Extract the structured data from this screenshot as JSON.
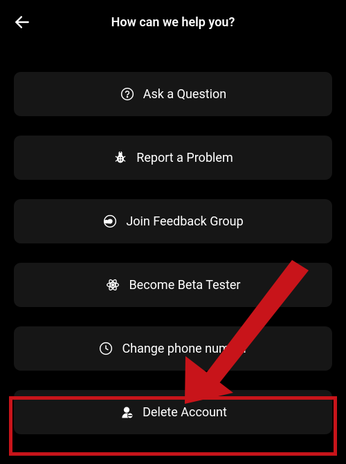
{
  "header": {
    "title": "How can we help you?"
  },
  "options": {
    "ask_question": {
      "label": "Ask a Question",
      "icon": "question-circle-icon"
    },
    "report_problem": {
      "label": "Report a Problem",
      "icon": "bug-icon"
    },
    "feedback_group": {
      "label": "Join Feedback Group",
      "icon": "chat-bubble-icon"
    },
    "beta_tester": {
      "label": "Become Beta Tester",
      "icon": "atom-icon"
    },
    "change_phone": {
      "label": "Change phone number",
      "icon": "clock-icon"
    },
    "delete_account": {
      "label": "Delete Account",
      "icon": "delete-user-icon"
    }
  },
  "annotation": {
    "highlight_target": "delete-account-button",
    "arrow_color": "#c8141a"
  }
}
